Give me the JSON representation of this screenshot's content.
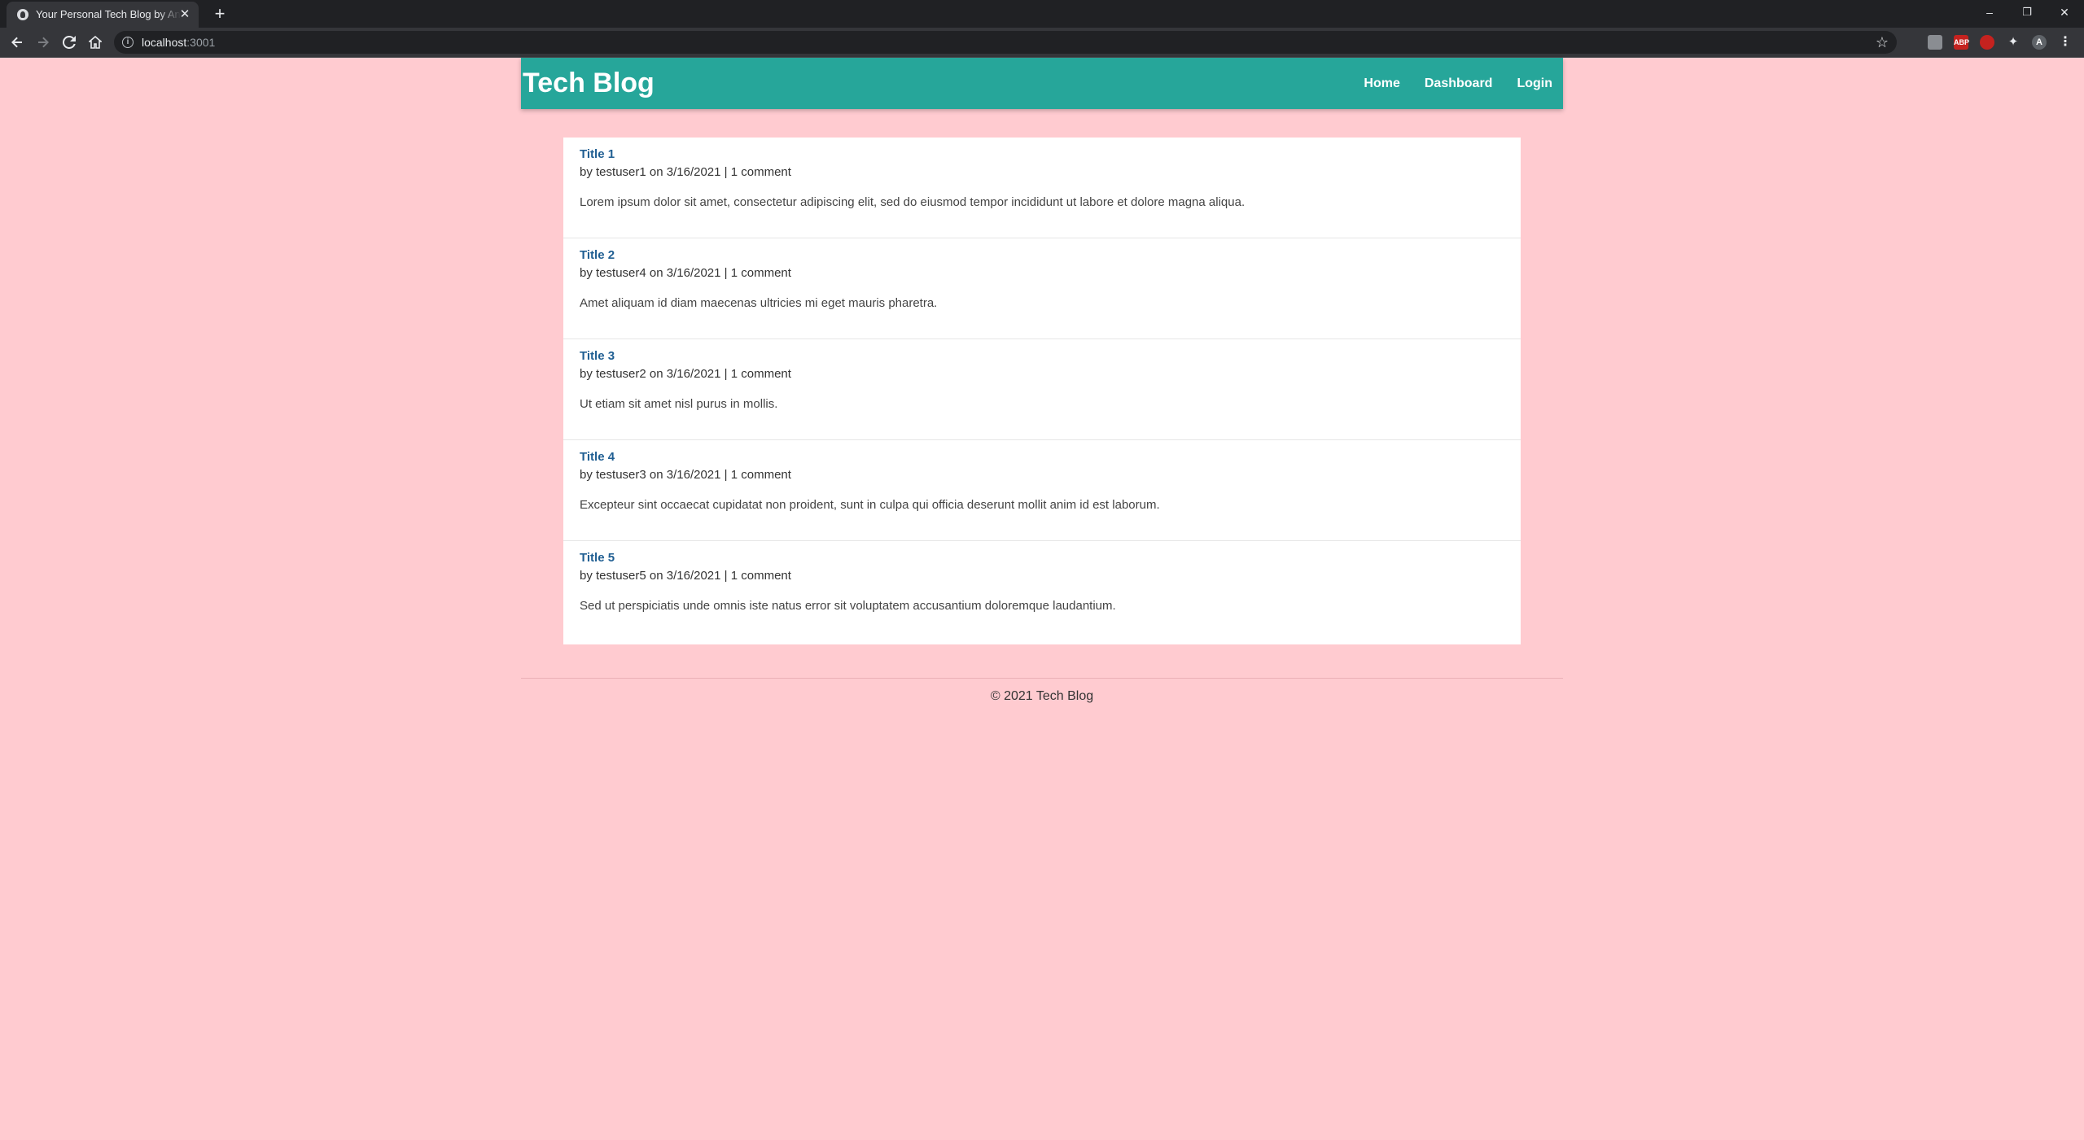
{
  "browser": {
    "tab_title": "Your Personal Tech Blog by Andr",
    "tab_close": "✕",
    "new_tab": "+",
    "url_host": "localhost",
    "url_port": ":3001",
    "window_controls": [
      "–",
      "❐",
      "✕"
    ],
    "extensions": [
      {
        "name": "ext-gray-icon",
        "label": ""
      },
      {
        "name": "adblock-icon",
        "label": "ABP"
      },
      {
        "name": "ext-red-icon",
        "label": ""
      },
      {
        "name": "puzzle-icon",
        "label": ""
      },
      {
        "name": "profile-avatar",
        "label": "A"
      }
    ]
  },
  "header": {
    "logo": "Tech Blog",
    "nav": [
      "Home",
      "Dashboard",
      "Login"
    ]
  },
  "posts": [
    {
      "title": "Title 1",
      "user": "testuser1",
      "date": "3/16/2021",
      "comments": "1 comment",
      "body": "Lorem ipsum dolor sit amet, consectetur adipiscing elit, sed do eiusmod tempor incididunt ut labore et dolore magna aliqua."
    },
    {
      "title": "Title 2",
      "user": "testuser4",
      "date": "3/16/2021",
      "comments": "1 comment",
      "body": "Amet aliquam id diam maecenas ultricies mi eget mauris pharetra."
    },
    {
      "title": "Title 3",
      "user": "testuser2",
      "date": "3/16/2021",
      "comments": "1 comment",
      "body": "Ut etiam sit amet nisl purus in mollis."
    },
    {
      "title": "Title 4",
      "user": "testuser3",
      "date": "3/16/2021",
      "comments": "1 comment",
      "body": "Excepteur sint occaecat cupidatat non proident, sunt in culpa qui officia deserunt mollit anim id est laborum."
    },
    {
      "title": "Title 5",
      "user": "testuser5",
      "date": "3/16/2021",
      "comments": "1 comment",
      "body": "Sed ut perspiciatis unde omnis iste natus error sit voluptatem accusantium doloremque laudantium."
    }
  ],
  "post_meta": {
    "by": "by",
    "on": "on",
    "sep": "|"
  },
  "footer": "© 2021 Tech Blog",
  "colors": {
    "page_background": "#ffcbd0",
    "header_background": "#26a69a",
    "title_link": "#1f5e92"
  }
}
